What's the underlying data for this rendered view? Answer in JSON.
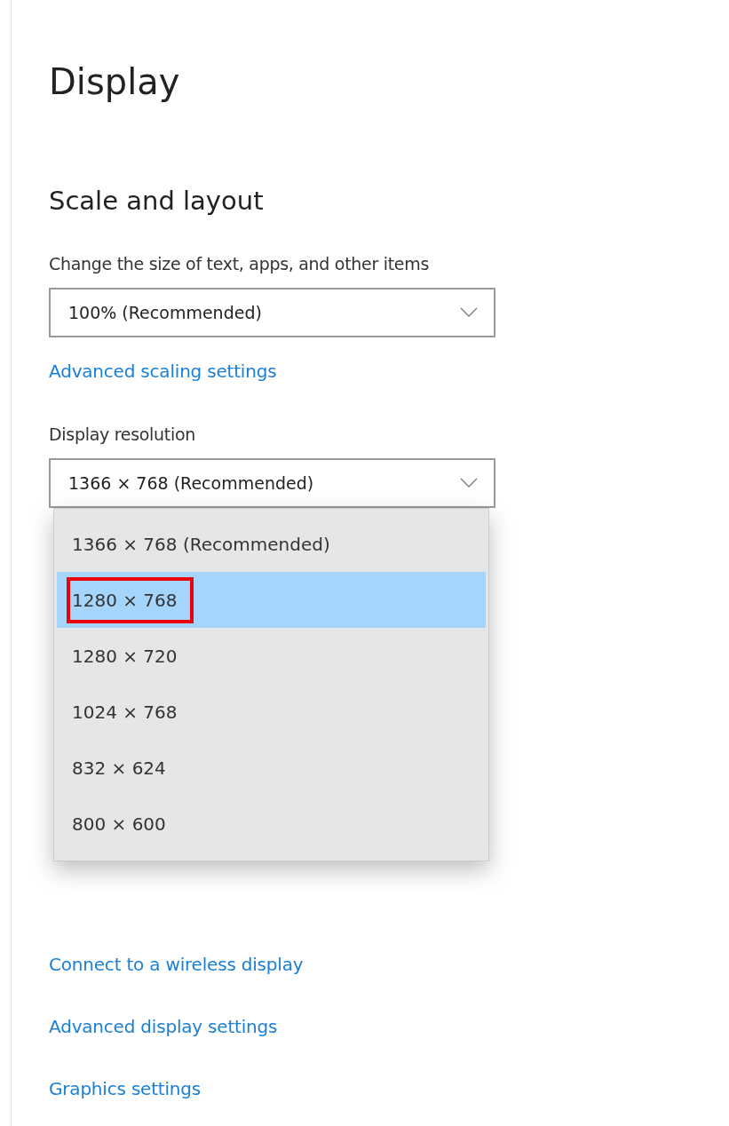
{
  "page_title": "Display",
  "section_title": "Scale and layout",
  "scale": {
    "label": "Change the size of text, apps, and other items",
    "value": "100% (Recommended)"
  },
  "scaling_link": "Advanced scaling settings",
  "resolution": {
    "label": "Display resolution",
    "value": "1366 × 768 (Recommended)",
    "expanded": true
  },
  "resolution_options": [
    {
      "label": "1366 × 768 (Recommended)",
      "selected": false,
      "outlined": false
    },
    {
      "label": "1280 × 768",
      "selected": true,
      "outlined": true
    },
    {
      "label": "1280 × 720",
      "selected": false,
      "outlined": false
    },
    {
      "label": "1024 × 768",
      "selected": false,
      "outlined": false
    },
    {
      "label": "832 × 624",
      "selected": false,
      "outlined": false
    },
    {
      "label": "800 × 600",
      "selected": false,
      "outlined": false
    }
  ],
  "links": [
    "Connect to a wireless display",
    "Advanced display settings",
    "Graphics settings"
  ]
}
